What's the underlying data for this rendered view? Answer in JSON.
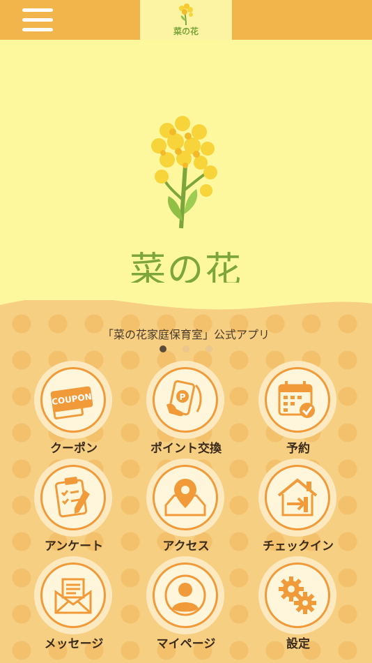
{
  "header": {
    "menu_icon": "hamburger-icon",
    "logo_text": "菜の花"
  },
  "hero": {
    "title": "菜の花"
  },
  "subtitle": "「菜の花家庭保育室」公式アプリ",
  "carousel": {
    "count": 3,
    "active": 1
  },
  "colors": {
    "header": "#f1b54c",
    "hero_bg": "#fdf79e",
    "accent_orange": "#f19a3a",
    "brand_green": "#7ca63c"
  },
  "menu": [
    {
      "label": "クーポン",
      "icon": "coupon-icon"
    },
    {
      "label": "ポイント交換",
      "icon": "point-exchange-icon"
    },
    {
      "label": "予約",
      "icon": "calendar-icon"
    },
    {
      "label": "アンケート",
      "icon": "survey-clipboard-icon"
    },
    {
      "label": "アクセス",
      "icon": "map-pin-icon"
    },
    {
      "label": "チェックイン",
      "icon": "check-in-house-icon"
    },
    {
      "label": "メッセージ",
      "icon": "message-envelope-icon"
    },
    {
      "label": "マイページ",
      "icon": "user-icon"
    },
    {
      "label": "設定",
      "icon": "gears-icon"
    }
  ]
}
